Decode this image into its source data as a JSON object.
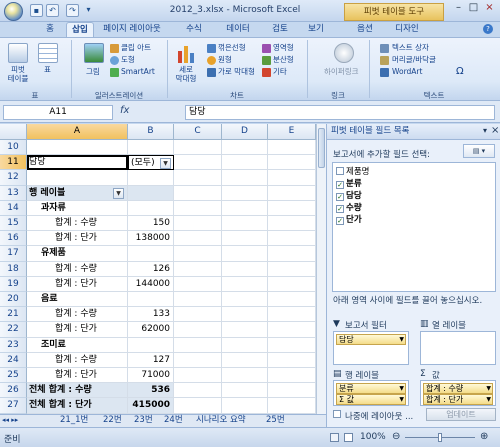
{
  "window": {
    "title": "2012_3.xlsx - Microsoft Excel",
    "context_tab_title": "피벗 테이블 도구",
    "controls": [
      "–",
      "□",
      "×"
    ]
  },
  "tabs": [
    "홈",
    "삽입",
    "페이지 레이아웃",
    "수식",
    "데이터",
    "검토",
    "보기",
    "옵션",
    "디자인"
  ],
  "ribbon": {
    "groups": [
      {
        "label": "표",
        "items": [
          "피벗\n테이블",
          "표"
        ]
      },
      {
        "label": "일러스트레이션",
        "items": [
          "그림",
          "클립 아트",
          "도형",
          "SmartArt"
        ]
      },
      {
        "label": "차트",
        "items": [
          "세로\n막대형",
          "꺾은선형",
          "원형",
          "가로 막대형",
          "영역형",
          "분산형",
          "기타"
        ]
      },
      {
        "label": "링크",
        "items": [
          "하이퍼링크"
        ]
      },
      {
        "label": "텍스트",
        "items": [
          "텍스트 상자",
          "머리글/바닥글",
          "WordArt",
          "Ω"
        ]
      }
    ]
  },
  "formula_bar": {
    "name_box": "A11",
    "fx": "fx",
    "value": "담당"
  },
  "sheet": {
    "columns": [
      "A",
      "B",
      "C",
      "D",
      "E"
    ],
    "selected_column": "A",
    "selected_row": "11",
    "rows": [
      {
        "num": "10",
        "a": "",
        "b": ""
      },
      {
        "num": "11",
        "a": "담당",
        "b": "(모두)",
        "dropdown": true
      },
      {
        "num": "12",
        "a": "",
        "b": ""
      },
      {
        "num": "13",
        "a": "행 레이블",
        "b": "",
        "dropdown_a": true
      },
      {
        "num": "14",
        "a": "과자류",
        "b": ""
      },
      {
        "num": "15",
        "a": "합계 : 수량",
        "b": "150"
      },
      {
        "num": "16",
        "a": "합계 : 단가",
        "b": "138000"
      },
      {
        "num": "17",
        "a": "유제품",
        "b": ""
      },
      {
        "num": "18",
        "a": "합계 : 수량",
        "b": "126"
      },
      {
        "num": "19",
        "a": "합계 : 단가",
        "b": "144000"
      },
      {
        "num": "20",
        "a": "음료",
        "b": ""
      },
      {
        "num": "21",
        "a": "합계 : 수량",
        "b": "133"
      },
      {
        "num": "22",
        "a": "합계 : 단가",
        "b": "62000"
      },
      {
        "num": "23",
        "a": "조미료",
        "b": ""
      },
      {
        "num": "24",
        "a": "합계 : 수량",
        "b": "127"
      },
      {
        "num": "25",
        "a": "합계 : 단가",
        "b": "71000"
      },
      {
        "num": "26",
        "a": "전체 합계 : 수량",
        "b": "536"
      },
      {
        "num": "27",
        "a": "전체 합계 : 단가",
        "b": "415000"
      }
    ],
    "tabs": [
      "21_1번",
      "22번",
      "23번",
      "24번",
      "시나리오 요약",
      "25번"
    ]
  },
  "status": {
    "ready": "준비",
    "zoom": "100%"
  },
  "pane": {
    "title": "피벗 테이블 필드 목록",
    "choose_label": "보고서에 추가할 필드 선택:",
    "fields": [
      {
        "name": "제품명",
        "checked": false
      },
      {
        "name": "분류",
        "checked": true
      },
      {
        "name": "담당",
        "checked": true
      },
      {
        "name": "수량",
        "checked": true
      },
      {
        "name": "단가",
        "checked": true
      }
    ],
    "drag_label": "아래 영역 사이에 필드를 끌어 놓으십시오.",
    "zones": {
      "report_filter_label": "보고서 필터",
      "column_label": "열 레이블",
      "row_label": "행 레이블",
      "values_label": "값",
      "filter_items": [
        "담당"
      ],
      "column_items": [],
      "row_items": [
        "분류",
        "Σ 값"
      ],
      "values_items": [
        "합계 : 수량",
        "합계 : 단가"
      ]
    },
    "defer_label": "나중에 레이아웃 ...",
    "update_label": "업데이트"
  }
}
